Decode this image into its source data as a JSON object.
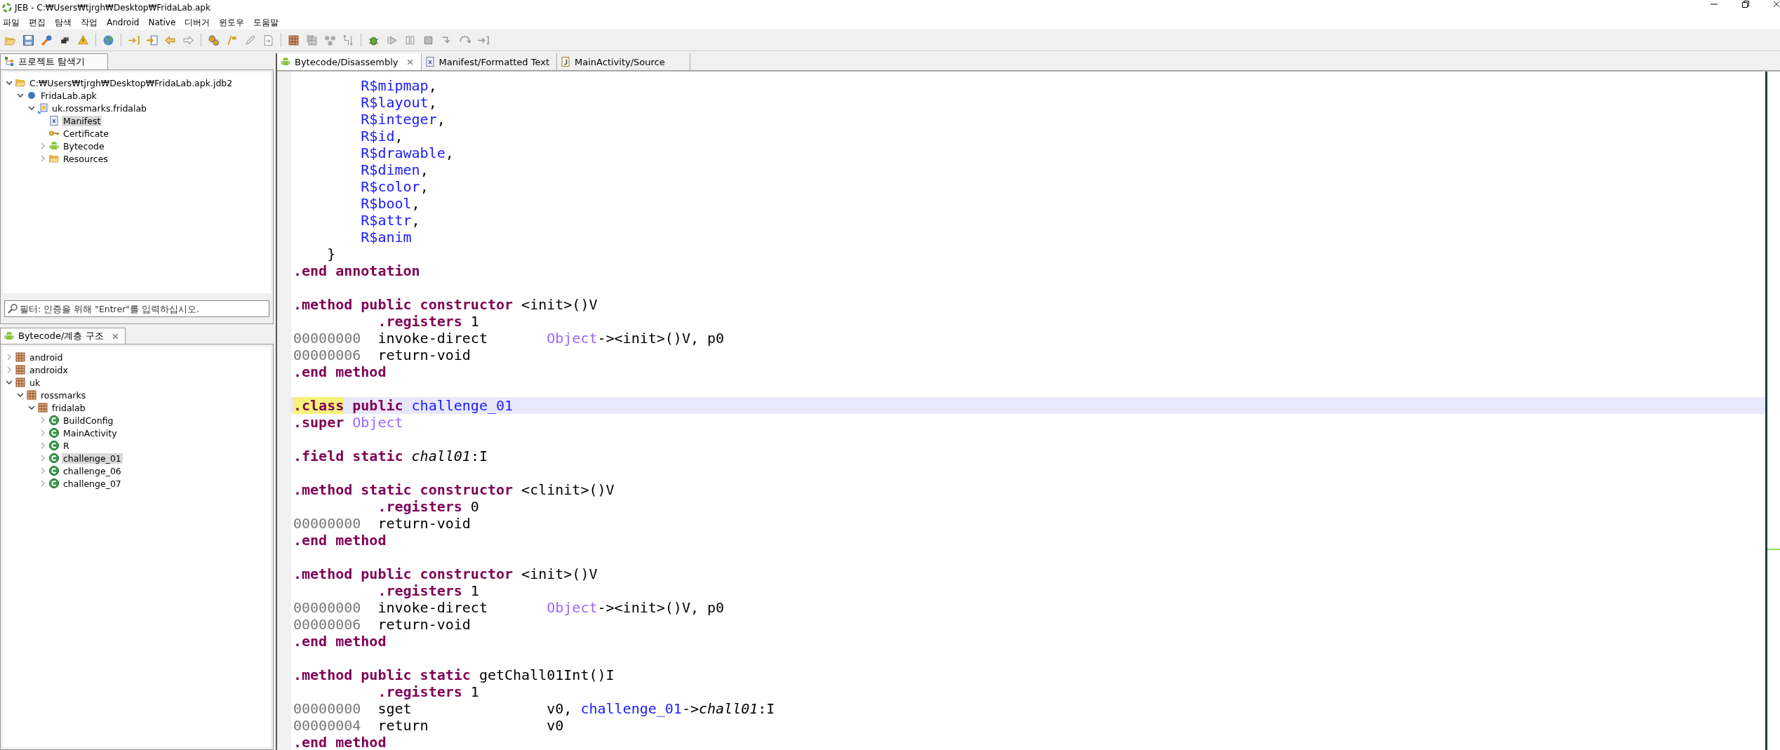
{
  "window": {
    "title": "JEB - C:₩Users₩tjrgh₩Desktop₩FridaLab.apk"
  },
  "menu": [
    "파일",
    "편집",
    "탐색",
    "작업",
    "Android",
    "Native",
    "디버거",
    "윈도우",
    "도움말"
  ],
  "project_explorer": {
    "tab": {
      "label": "프로젝트 탐색기",
      "selected": true
    },
    "tree": [
      {
        "label": "C:₩Users₩tjrgh₩Desktop₩FridaLab.apk.jdb2",
        "kind": "folder",
        "expanded": true,
        "selected": false,
        "children": [
          {
            "label": "FridaLab.apk",
            "kind": "apk",
            "expanded": true,
            "selected": false,
            "children": [
              {
                "label": "uk.rossmarks.fridalab",
                "kind": "apkpkg",
                "expanded": true,
                "selected": false,
                "children": [
                  {
                    "label": "Manifest",
                    "kind": "manifest",
                    "selected": true
                  },
                  {
                    "label": "Certificate",
                    "kind": "key",
                    "selected": false
                  },
                  {
                    "label": "Bytecode",
                    "kind": "android",
                    "expanded": false,
                    "selected": false
                  },
                  {
                    "label": "Resources",
                    "kind": "folder",
                    "expanded": false,
                    "selected": false
                  }
                ]
              }
            ]
          }
        ]
      }
    ],
    "filter": {
      "placeholder": "필터: 인증을 위해 \"Entrer\"를 입력하십시오."
    }
  },
  "hierarchy": {
    "tab": {
      "label": "Bytecode/계층 구조",
      "selected": true
    },
    "tree": [
      {
        "label": "android",
        "kind": "package",
        "expanded": false,
        "selected": false
      },
      {
        "label": "androidx",
        "kind": "package",
        "expanded": false,
        "selected": false
      },
      {
        "label": "uk",
        "kind": "package",
        "expanded": true,
        "selected": false,
        "children": [
          {
            "label": "rossmarks",
            "kind": "package",
            "expanded": true,
            "selected": false,
            "children": [
              {
                "label": "fridalab",
                "kind": "package",
                "expanded": true,
                "selected": false,
                "children": [
                  {
                    "label": "BuildConfig",
                    "kind": "class",
                    "expanded": false,
                    "selected": false
                  },
                  {
                    "label": "MainActivity",
                    "kind": "class",
                    "expanded": false,
                    "selected": false
                  },
                  {
                    "label": "R",
                    "kind": "class",
                    "expanded": false,
                    "selected": false
                  },
                  {
                    "label": "challenge_01",
                    "kind": "class",
                    "expanded": false,
                    "selected": true
                  },
                  {
                    "label": "challenge_06",
                    "kind": "class",
                    "expanded": false,
                    "selected": false
                  },
                  {
                    "label": "challenge_07",
                    "kind": "class",
                    "expanded": false,
                    "selected": false
                  }
                ]
              }
            ]
          }
        ]
      }
    ]
  },
  "editor": {
    "tabs": [
      {
        "label": "Bytecode/Disassembly",
        "kind": "android",
        "selected": true
      },
      {
        "label": "Manifest/Formatted Text",
        "kind": "xml",
        "selected": false
      },
      {
        "label": "MainActivity/Source",
        "kind": "java",
        "selected": false
      }
    ],
    "lines": [
      {
        "selected": false,
        "tokens": [
          {
            "t": "        R$mipmap",
            "kind": "ref"
          },
          {
            "t": ",",
            "kind": "text"
          }
        ]
      },
      {
        "selected": false,
        "tokens": [
          {
            "t": "        R$layout",
            "kind": "ref"
          },
          {
            "t": ",",
            "kind": "text"
          }
        ]
      },
      {
        "selected": false,
        "tokens": [
          {
            "t": "        R$integer",
            "kind": "ref"
          },
          {
            "t": ",",
            "kind": "text"
          }
        ]
      },
      {
        "selected": false,
        "tokens": [
          {
            "t": "        R$id",
            "kind": "ref"
          },
          {
            "t": ",",
            "kind": "text"
          }
        ]
      },
      {
        "selected": false,
        "tokens": [
          {
            "t": "        R$drawable",
            "kind": "ref"
          },
          {
            "t": ",",
            "kind": "text"
          }
        ]
      },
      {
        "selected": false,
        "tokens": [
          {
            "t": "        R$dimen",
            "kind": "ref"
          },
          {
            "t": ",",
            "kind": "text"
          }
        ]
      },
      {
        "selected": false,
        "tokens": [
          {
            "t": "        R$color",
            "kind": "ref"
          },
          {
            "t": ",",
            "kind": "text"
          }
        ]
      },
      {
        "selected": false,
        "tokens": [
          {
            "t": "        R$bool",
            "kind": "ref"
          },
          {
            "t": ",",
            "kind": "text"
          }
        ]
      },
      {
        "selected": false,
        "tokens": [
          {
            "t": "        R$attr",
            "kind": "ref"
          },
          {
            "t": ",",
            "kind": "text"
          }
        ]
      },
      {
        "selected": false,
        "tokens": [
          {
            "t": "        R$anim",
            "kind": "ref"
          }
        ]
      },
      {
        "selected": false,
        "tokens": [
          {
            "t": "    }",
            "kind": "text"
          }
        ]
      },
      {
        "selected": false,
        "tokens": [
          {
            "t": ".end annotation",
            "kind": "kw"
          }
        ]
      },
      {
        "selected": false
      },
      {
        "selected": false,
        "tokens": [
          {
            "t": ".method public constructor ",
            "kind": "kw"
          },
          {
            "t": "<init>()V",
            "kind": "text"
          }
        ]
      },
      {
        "selected": false,
        "tokens": [
          {
            "t": "          .registers",
            "kind": "kw"
          },
          {
            "t": " 1",
            "kind": "text"
          }
        ]
      },
      {
        "selected": false,
        "tokens": [
          {
            "t": "00000000",
            "kind": "addr"
          },
          {
            "t": "  invoke-direct       ",
            "kind": "text"
          },
          {
            "t": "Object",
            "kind": "type"
          },
          {
            "t": "-><init>()V, p0",
            "kind": "text"
          }
        ]
      },
      {
        "selected": false,
        "tokens": [
          {
            "t": "00000006",
            "kind": "addr"
          },
          {
            "t": "  return-void",
            "kind": "text"
          }
        ]
      },
      {
        "selected": false,
        "tokens": [
          {
            "t": ".end method",
            "kind": "kw"
          }
        ]
      },
      {
        "selected": false
      },
      {
        "selected": true,
        "tokens": [
          {
            "t": ".class",
            "kind": "match"
          },
          {
            "t": " public ",
            "kind": "kw"
          },
          {
            "t": "challenge_01",
            "kind": "ref"
          }
        ]
      },
      {
        "selected": false,
        "tokens": [
          {
            "t": ".super ",
            "kind": "kw"
          },
          {
            "t": "Object",
            "kind": "type"
          }
        ]
      },
      {
        "selected": false
      },
      {
        "selected": false,
        "tokens": [
          {
            "t": ".field static ",
            "kind": "kw"
          },
          {
            "t": "chall01",
            "kind": "field"
          },
          {
            "t": ":I",
            "kind": "text"
          }
        ]
      },
      {
        "selected": false
      },
      {
        "selected": false,
        "tokens": [
          {
            "t": ".method static constructor ",
            "kind": "kw"
          },
          {
            "t": "<clinit>()V",
            "kind": "text"
          }
        ]
      },
      {
        "selected": false,
        "tokens": [
          {
            "t": "          .registers",
            "kind": "kw"
          },
          {
            "t": " 0",
            "kind": "text"
          }
        ]
      },
      {
        "selected": false,
        "tokens": [
          {
            "t": "00000000",
            "kind": "addr"
          },
          {
            "t": "  return-void",
            "kind": "text"
          }
        ]
      },
      {
        "selected": false,
        "tokens": [
          {
            "t": ".end method",
            "kind": "kw"
          }
        ]
      },
      {
        "selected": false
      },
      {
        "selected": false,
        "tokens": [
          {
            "t": ".method public constructor ",
            "kind": "kw"
          },
          {
            "t": "<init>()V",
            "kind": "text"
          }
        ]
      },
      {
        "selected": false,
        "tokens": [
          {
            "t": "          .registers",
            "kind": "kw"
          },
          {
            "t": " 1",
            "kind": "text"
          }
        ]
      },
      {
        "selected": false,
        "tokens": [
          {
            "t": "00000000",
            "kind": "addr"
          },
          {
            "t": "  invoke-direct       ",
            "kind": "text"
          },
          {
            "t": "Object",
            "kind": "type"
          },
          {
            "t": "-><init>()V, p0",
            "kind": "text"
          }
        ]
      },
      {
        "selected": false,
        "tokens": [
          {
            "t": "00000006",
            "kind": "addr"
          },
          {
            "t": "  return-void",
            "kind": "text"
          }
        ]
      },
      {
        "selected": false,
        "tokens": [
          {
            "t": ".end method",
            "kind": "kw"
          }
        ]
      },
      {
        "selected": false
      },
      {
        "selected": false,
        "tokens": [
          {
            "t": ".method public static ",
            "kind": "kw"
          },
          {
            "t": "getChall01Int()I",
            "kind": "text"
          }
        ]
      },
      {
        "selected": false,
        "tokens": [
          {
            "t": "          .registers",
            "kind": "kw"
          },
          {
            "t": " 1",
            "kind": "text"
          }
        ]
      },
      {
        "selected": false,
        "tokens": [
          {
            "t": "00000000",
            "kind": "addr"
          },
          {
            "t": "  sget                v0, ",
            "kind": "text"
          },
          {
            "t": "challenge_01",
            "kind": "ref"
          },
          {
            "t": "->",
            "kind": "text"
          },
          {
            "t": "chall01",
            "kind": "field"
          },
          {
            "t": ":I",
            "kind": "text"
          }
        ]
      },
      {
        "selected": false,
        "tokens": [
          {
            "t": "00000004",
            "kind": "addr"
          },
          {
            "t": "  return              v0",
            "kind": "text"
          }
        ]
      },
      {
        "selected": false,
        "tokens": [
          {
            "t": ".end method",
            "kind": "kw"
          }
        ]
      }
    ]
  }
}
